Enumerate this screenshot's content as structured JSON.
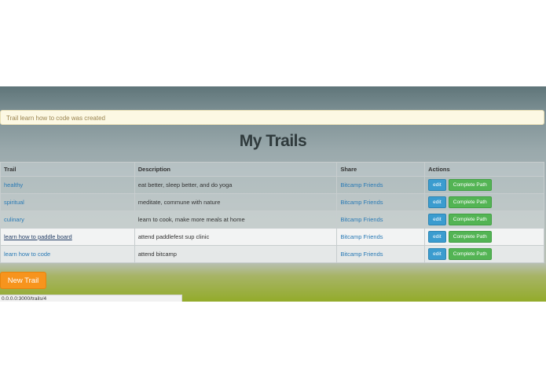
{
  "flash": {
    "message": "Trail learn how to code was created"
  },
  "page": {
    "title": "My Trails"
  },
  "table": {
    "headers": [
      "Trail",
      "Description",
      "Share",
      "Actions"
    ],
    "rows": [
      {
        "trail": "healthy",
        "description": "eat better, sleep better, and do yoga",
        "share": "Bitcamp Friends",
        "edit": "edit",
        "complete": "Complete Path"
      },
      {
        "trail": "spiritual",
        "description": "meditate, commune with nature",
        "share": "Bitcamp Friends",
        "edit": "edit",
        "complete": "Complete Path"
      },
      {
        "trail": "culinary",
        "description": "learn to cook, make more meals at home",
        "share": "Bitcamp Friends",
        "edit": "edit",
        "complete": "Complete Path"
      },
      {
        "trail": "learn how to paddle board",
        "description": "attend paddlefest sup clinic",
        "share": "Bitcamp Friends",
        "edit": "edit",
        "complete": "Complete Path"
      },
      {
        "trail": "learn how to code",
        "description": "attend bitcamp",
        "share": "Bitcamp Friends",
        "edit": "edit",
        "complete": "Complete Path"
      }
    ]
  },
  "actions": {
    "new_trail_label": "New Trail"
  },
  "statusbar": {
    "url": "0.0.0.0:3000/trails/4"
  },
  "colors": {
    "link": "#2a7ab5",
    "edit_button": "#3b9ccf",
    "complete_button": "#53b454",
    "new_trail_button": "#f7941d",
    "flash_background": "#fcf8e3"
  }
}
